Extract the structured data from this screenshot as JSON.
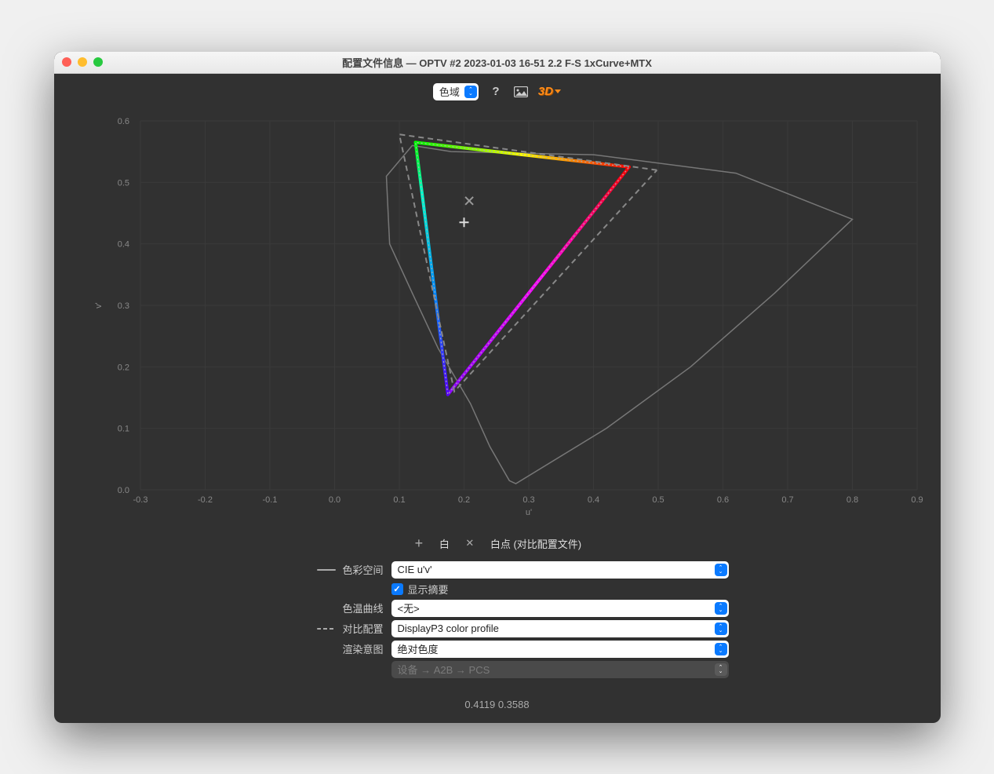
{
  "window": {
    "title": "配置文件信息 — OPTV #2 2023-01-03 16-51 2.2 F-S 1xCurve+MTX"
  },
  "toolbar": {
    "view_select": "色域",
    "three_d": "3D"
  },
  "legend": {
    "white": "白",
    "whitepoint": "白点 (对比配置文件)"
  },
  "labels": {
    "color_space": "色彩空间",
    "show_summary": "显示摘要",
    "temp_curve": "色温曲线",
    "compare_profile": "对比配置",
    "rendering_intent": "渲染意图"
  },
  "values": {
    "color_space": "CIE u'v'",
    "temp_curve": "<无>",
    "compare_profile": "DisplayP3 color profile",
    "rendering_intent": "绝对色度",
    "direction": "设备 → A2B → PCS"
  },
  "footer": {
    "coords": "0.4119 0.3588"
  },
  "chart_data": {
    "type": "scatter",
    "xlabel": "u'",
    "ylabel": "v'",
    "xlim": [
      -0.3,
      0.9
    ],
    "ylim": [
      0.0,
      0.6
    ],
    "x_ticks": [
      -0.3,
      -0.2,
      -0.1,
      -0.0,
      0.1,
      0.2,
      0.3,
      0.4,
      0.5,
      0.6,
      0.7,
      0.8,
      0.9
    ],
    "y_ticks": [
      0.0,
      0.1,
      0.2,
      0.3,
      0.4,
      0.5,
      0.6
    ],
    "series": [
      {
        "name": "spectral_locus",
        "style": "outline",
        "points": [
          [
            0.18,
            0.55
          ],
          [
            0.12,
            0.56
          ],
          [
            0.08,
            0.51
          ],
          [
            0.085,
            0.4
          ],
          [
            0.12,
            0.32
          ],
          [
            0.16,
            0.23
          ],
          [
            0.21,
            0.14
          ],
          [
            0.24,
            0.07
          ],
          [
            0.27,
            0.015
          ],
          [
            0.28,
            0.01
          ],
          [
            0.42,
            0.1
          ],
          [
            0.55,
            0.2
          ],
          [
            0.68,
            0.32
          ],
          [
            0.8,
            0.44
          ],
          [
            0.62,
            0.515
          ],
          [
            0.4,
            0.545
          ],
          [
            0.18,
            0.55
          ]
        ]
      },
      {
        "name": "profile_gamut",
        "style": "rainbow-triangle",
        "points": [
          [
            0.455,
            0.525
          ],
          [
            0.125,
            0.565
          ],
          [
            0.175,
            0.155
          ],
          [
            0.455,
            0.525
          ]
        ]
      },
      {
        "name": "compare_gamut_DisplayP3",
        "style": "dashed",
        "points": [
          [
            0.498,
            0.52
          ],
          [
            0.1,
            0.578
          ],
          [
            0.185,
            0.16
          ],
          [
            0.498,
            0.52
          ]
        ]
      }
    ],
    "points": [
      {
        "name": "whitepoint_compare",
        "symbol": "x",
        "u": 0.208,
        "v": 0.47
      },
      {
        "name": "whitepoint_profile",
        "symbol": "+",
        "u": 0.2,
        "v": 0.435
      }
    ]
  }
}
